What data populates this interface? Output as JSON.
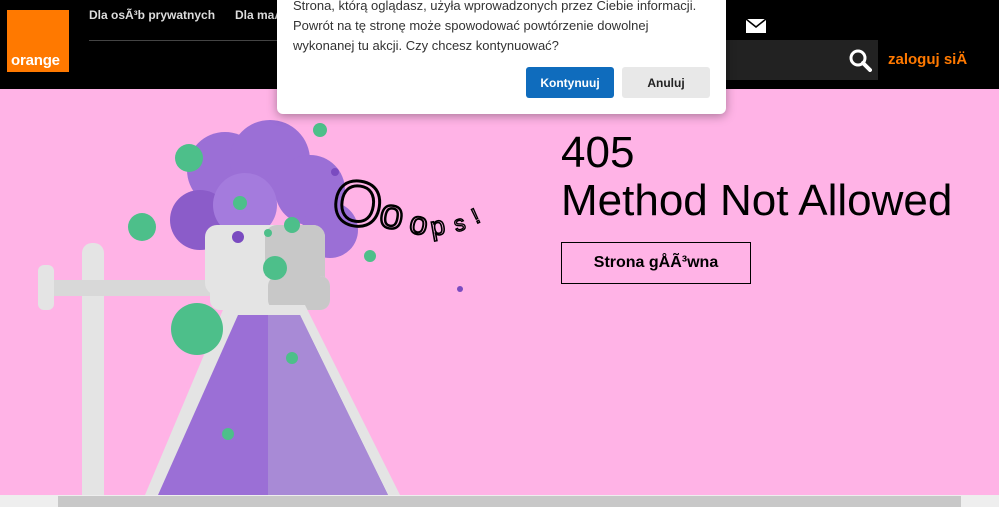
{
  "header": {
    "logo_text": "orange",
    "nav": [
      "Dla osÃ³b prywatnych",
      "Dla maÅ"
    ],
    "login_label": "zaloguj siÄ",
    "icons": [
      "mail-icon",
      "search-icon"
    ]
  },
  "error": {
    "code": "405",
    "message": "Method Not Allowed",
    "home_button": "Strona gÅÃ³wna",
    "illustration_text": "Ooops!"
  },
  "dialog": {
    "message": "Strona, którą oglądasz, użyła wprowadzonych przez Ciebie informacji. Powrót na tę stronę może spowodować powtórzenie dowolnej wykonanej tu akcji. Czy chcesz kontynuować?",
    "continue_label": "Kontynuuj",
    "cancel_label": "Anuluj"
  },
  "colors": {
    "brand_orange": "#ff7900",
    "background_pink": "#ffb3e6",
    "primary_blue": "#0f6cbd",
    "flask_purple": "#9b6fd6",
    "bubble_green": "#4dbf8a"
  }
}
